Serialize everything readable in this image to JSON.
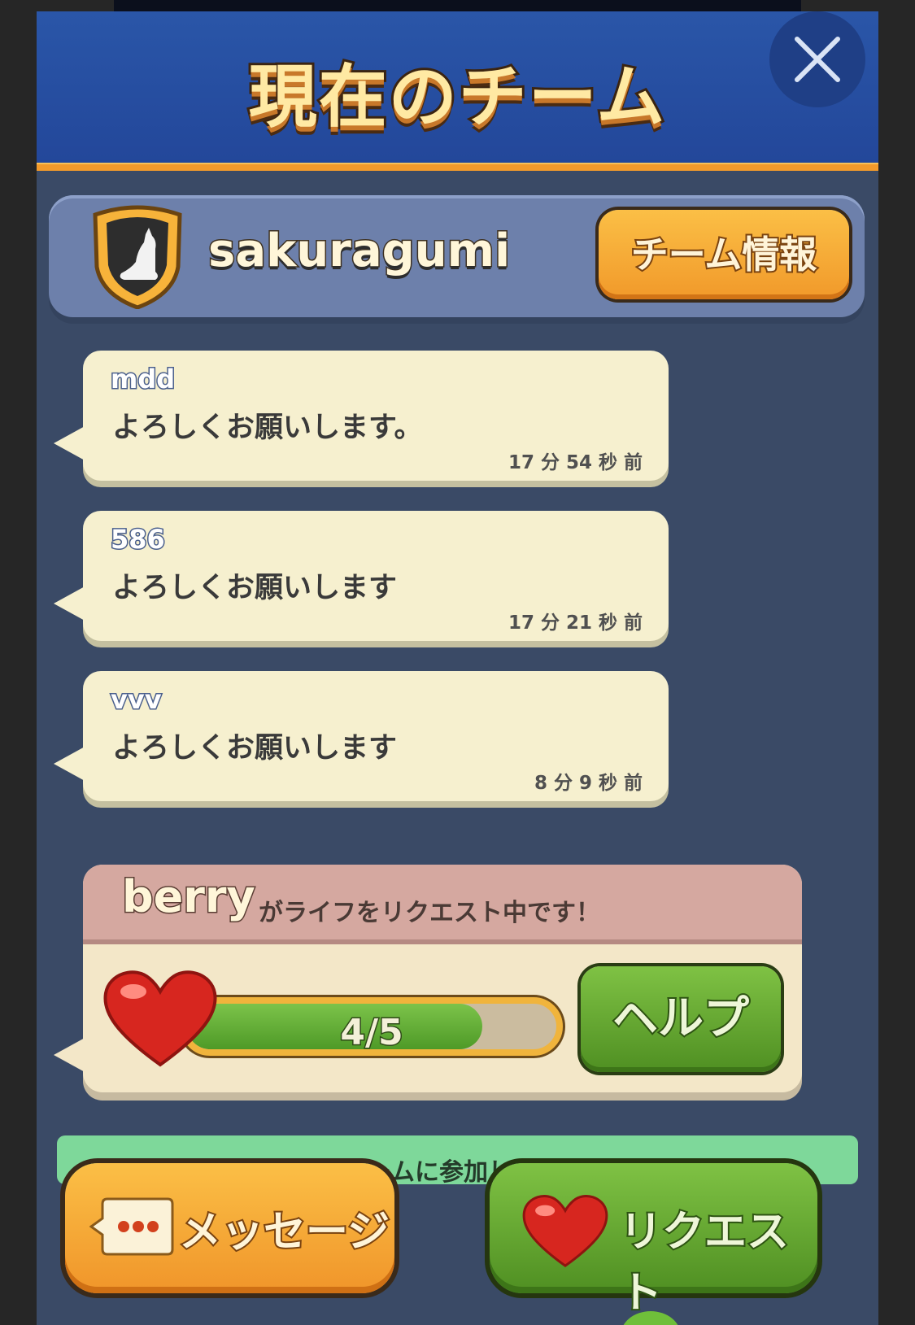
{
  "header": {
    "title": "現在のチーム"
  },
  "team": {
    "name": "sakuragumi",
    "info_button": "チーム情報"
  },
  "messages": [
    {
      "author": "mdd",
      "text": "よろしくお願いします。",
      "time": "17 分 54 秒 前"
    },
    {
      "author": "586",
      "text": "よろしくお願いします",
      "time": "17 分 21 秒 前"
    },
    {
      "author": "vvv",
      "text": "よろしくお願いします",
      "time": "8 分 9 秒 前"
    }
  ],
  "life_request": {
    "user": "berry",
    "text": "がライフをリクエスト中です！",
    "progress_label": "4/5",
    "progress_fraction": 0.8,
    "help_button": "ヘルプ"
  },
  "notice": {
    "text": "ﾘ ﾘ がチームに参加しました！"
  },
  "bottom": {
    "message_button": "メッセージ",
    "request_button": "リクエスト"
  },
  "colors": {
    "header": "#2a56a8",
    "panel": "#3a4a66",
    "orange": "#f39a2b",
    "green": "#5fa52e",
    "bubble": "#f6f0cf"
  }
}
